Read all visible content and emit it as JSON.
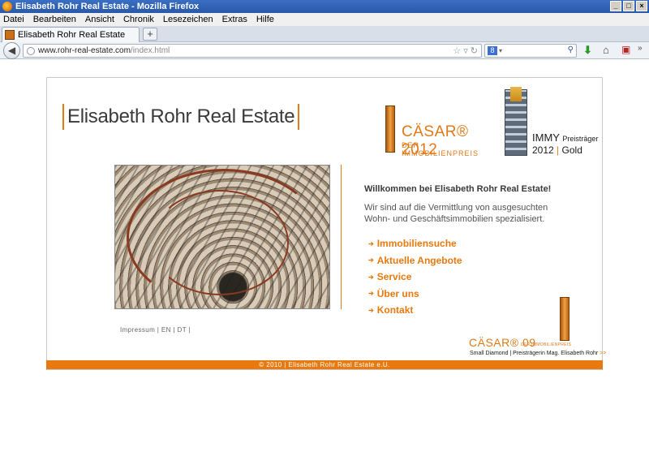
{
  "window": {
    "title": "Elisabeth Rohr Real Estate - Mozilla Firefox",
    "min_label": "_",
    "max_label": "□",
    "close_label": "×"
  },
  "menu": [
    "Datei",
    "Bearbeiten",
    "Ansicht",
    "Chronik",
    "Lesezeichen",
    "Extras",
    "Hilfe"
  ],
  "tab": {
    "title": "Elisabeth Rohr Real Estate",
    "close_label": "×",
    "new_tab_label": "+"
  },
  "url": {
    "host": "www.rohr-real-estate.com",
    "path": "/index.html"
  },
  "search": {
    "engine_label": "8",
    "placeholder": ""
  },
  "site": {
    "title": "Elisabeth Rohr Real Estate",
    "caesar2012": {
      "title": "CÄSAR® 2012",
      "subtitle": "DER IMMOBILIENPREIS"
    },
    "immy": {
      "title": "IMMY",
      "subtitle": "Preisträger",
      "year": "2012",
      "sep": "|",
      "rank": "Gold"
    },
    "welcome": "Willkommen bei Elisabeth Rohr Real Estate!",
    "intro": "Wir sind auf die Vermittlung von ausgesuchten Wohn- und Geschäftsimmobilien spezialisiert.",
    "nav": [
      "Immobiliensuche",
      "Aktuelle Angebote",
      "Service",
      "Über uns",
      "Kontakt"
    ],
    "footer_links": "Impressum | EN | DT |",
    "caesar09": {
      "title": "CÄSAR® 09",
      "subtitle": "DER IMMOBILIENPREIS",
      "line": "Small Diamond | Preisträgerin Mag. Elisabeth Rohr",
      "more": ">>"
    },
    "copyright": "© 2010 | Elisabeth Rohr Real Estate e.U."
  }
}
